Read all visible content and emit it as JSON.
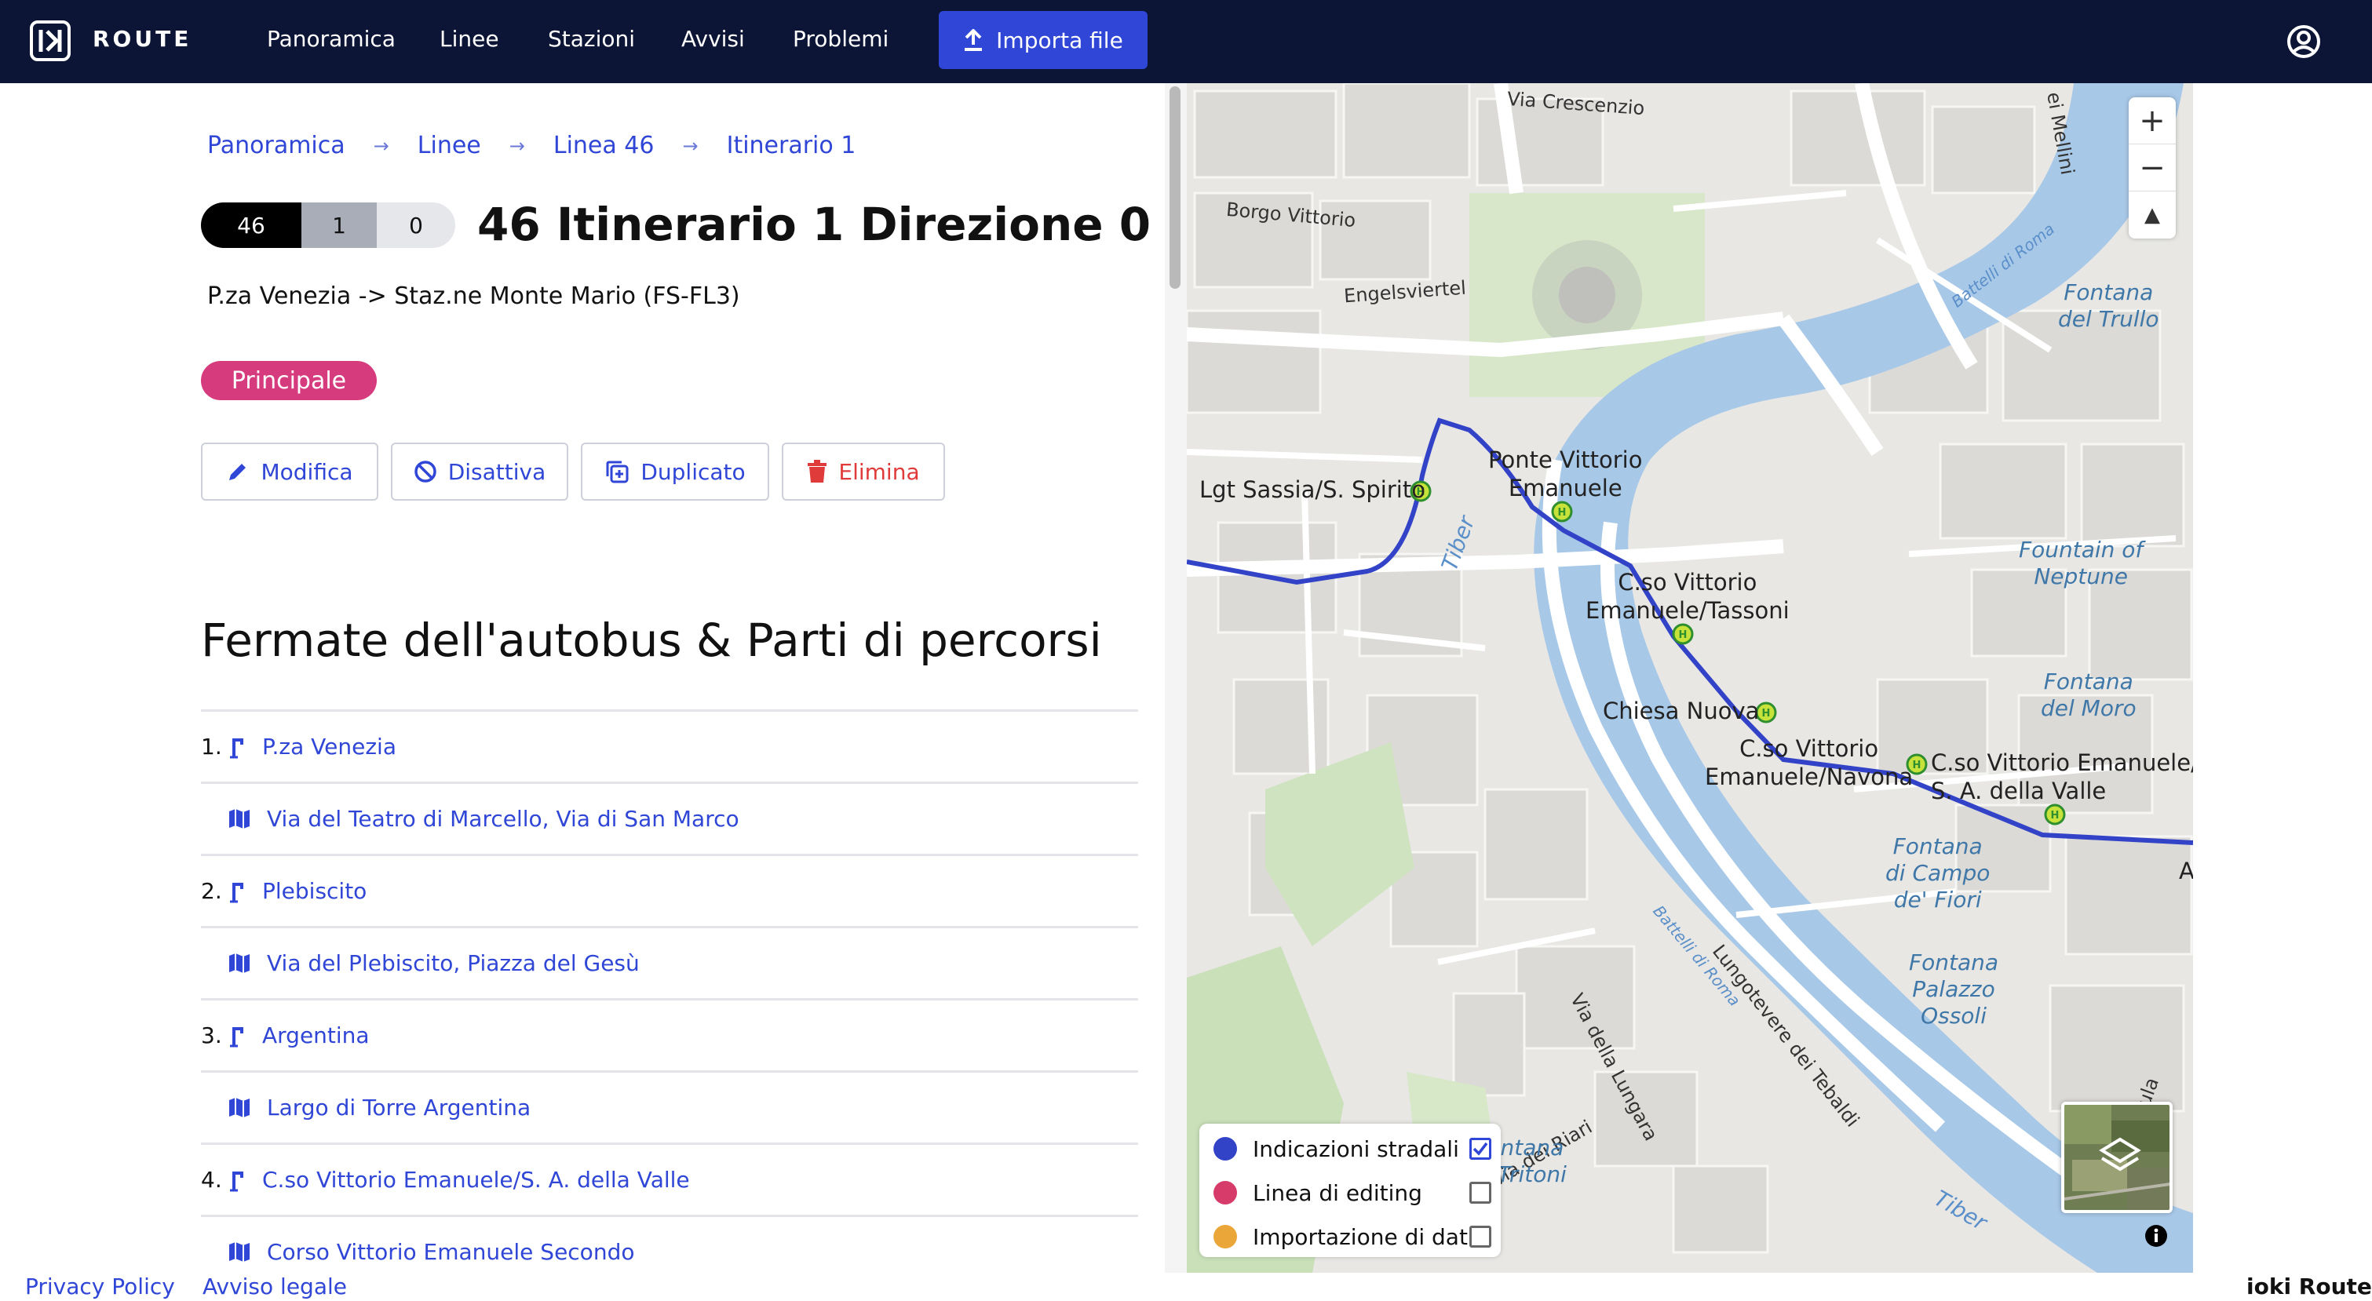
{
  "app": {
    "logo_text": "ROUTE",
    "nav": [
      "Panoramica",
      "Linee",
      "Stazioni",
      "Avvisi",
      "Problemi"
    ],
    "import_label": "Importa file"
  },
  "breadcrumb": [
    "Panoramica",
    "Linee",
    "Linea 46",
    "Itinerario 1"
  ],
  "route": {
    "pills": [
      "46",
      "1",
      "0"
    ],
    "title": "46 Itinerario 1 Direzione 0",
    "subtitle": "P.za Venezia -> Staz.ne Monte Mario (FS-FL3)",
    "badge": "Principale"
  },
  "actions": {
    "edit": "Modifica",
    "deactivate": "Disattiva",
    "duplicate": "Duplicato",
    "delete": "Elimina"
  },
  "section_title": "Fermate dell'autobus & Parti di percorsi",
  "stops": [
    {
      "type": "stop",
      "num": "1.",
      "label": "P.za Venezia"
    },
    {
      "type": "segment",
      "label": "Via del Teatro di Marcello, Via di San Marco"
    },
    {
      "type": "stop",
      "num": "2.",
      "label": "Plebiscito"
    },
    {
      "type": "segment",
      "label": "Via del Plebiscito, Piazza del Gesù"
    },
    {
      "type": "stop",
      "num": "3.",
      "label": "Argentina"
    },
    {
      "type": "segment",
      "label": "Largo di Torre Argentina"
    },
    {
      "type": "stop",
      "num": "4.",
      "label": "C.so Vittorio Emanuele/S. A. della Valle"
    },
    {
      "type": "segment",
      "label": "Corso Vittorio Emanuele Secondo"
    }
  ],
  "map": {
    "stops": {
      "a": "Lgt Sassia/S. Spirito",
      "b": "Ponte Vittorio\nEmanuele",
      "c": "C.so Vittorio\nEmanuele/Tassoni",
      "d": "Chiesa Nuova",
      "e": "C.so Vittorio\nEmanuele/Navona",
      "f": "C.so Vittorio Emanuele/\nS. A. della Valle",
      "g": "A"
    },
    "streets": {
      "s1": "Via Crescenzio",
      "s2": "Borgo Vittorio",
      "s3": "Engelsviertel",
      "s4": "Via della Lungara",
      "s5": "Lungotevere dei Tebaldi",
      "s6": "Via dei Riari",
      "s7": "ei Mellini",
      "s8": "renula"
    },
    "water": {
      "w1": "Tiber",
      "w2": "Tiber",
      "w3": "Battelli di Roma",
      "w4": "Battelli di Roma"
    },
    "pois": {
      "p1": "Fontana\ndel Trullo",
      "p2": "Fountain of\nNeptune",
      "p3": "Fontana\ndel Moro",
      "p4": "Fontana\ndi Campo\nde' Fiori",
      "p5": "Fontana\nPalazzo\nOssoli",
      "p6": "ntana\nTritoni"
    },
    "legend": [
      {
        "label": "Indicazioni stradali",
        "color": "#3343c8",
        "checked": true
      },
      {
        "label": "Linea di editing",
        "color": "#d63b6a",
        "checked": false
      },
      {
        "label": "Importazione di dati",
        "color": "#eba63a",
        "checked": false
      }
    ],
    "controls": {
      "zoom_in": "+",
      "zoom_out": "−",
      "reset": "▲"
    }
  },
  "footer": {
    "privacy": "Privacy Policy",
    "legal": "Avviso legale",
    "brand": "ioki Route"
  },
  "colors": {
    "nav_bg": "#0c1535",
    "primary": "#2f46d6",
    "badge": "#d63b7e",
    "danger": "#e03b3b",
    "route_line": "#3343c8",
    "river": "#a8c8e8"
  }
}
